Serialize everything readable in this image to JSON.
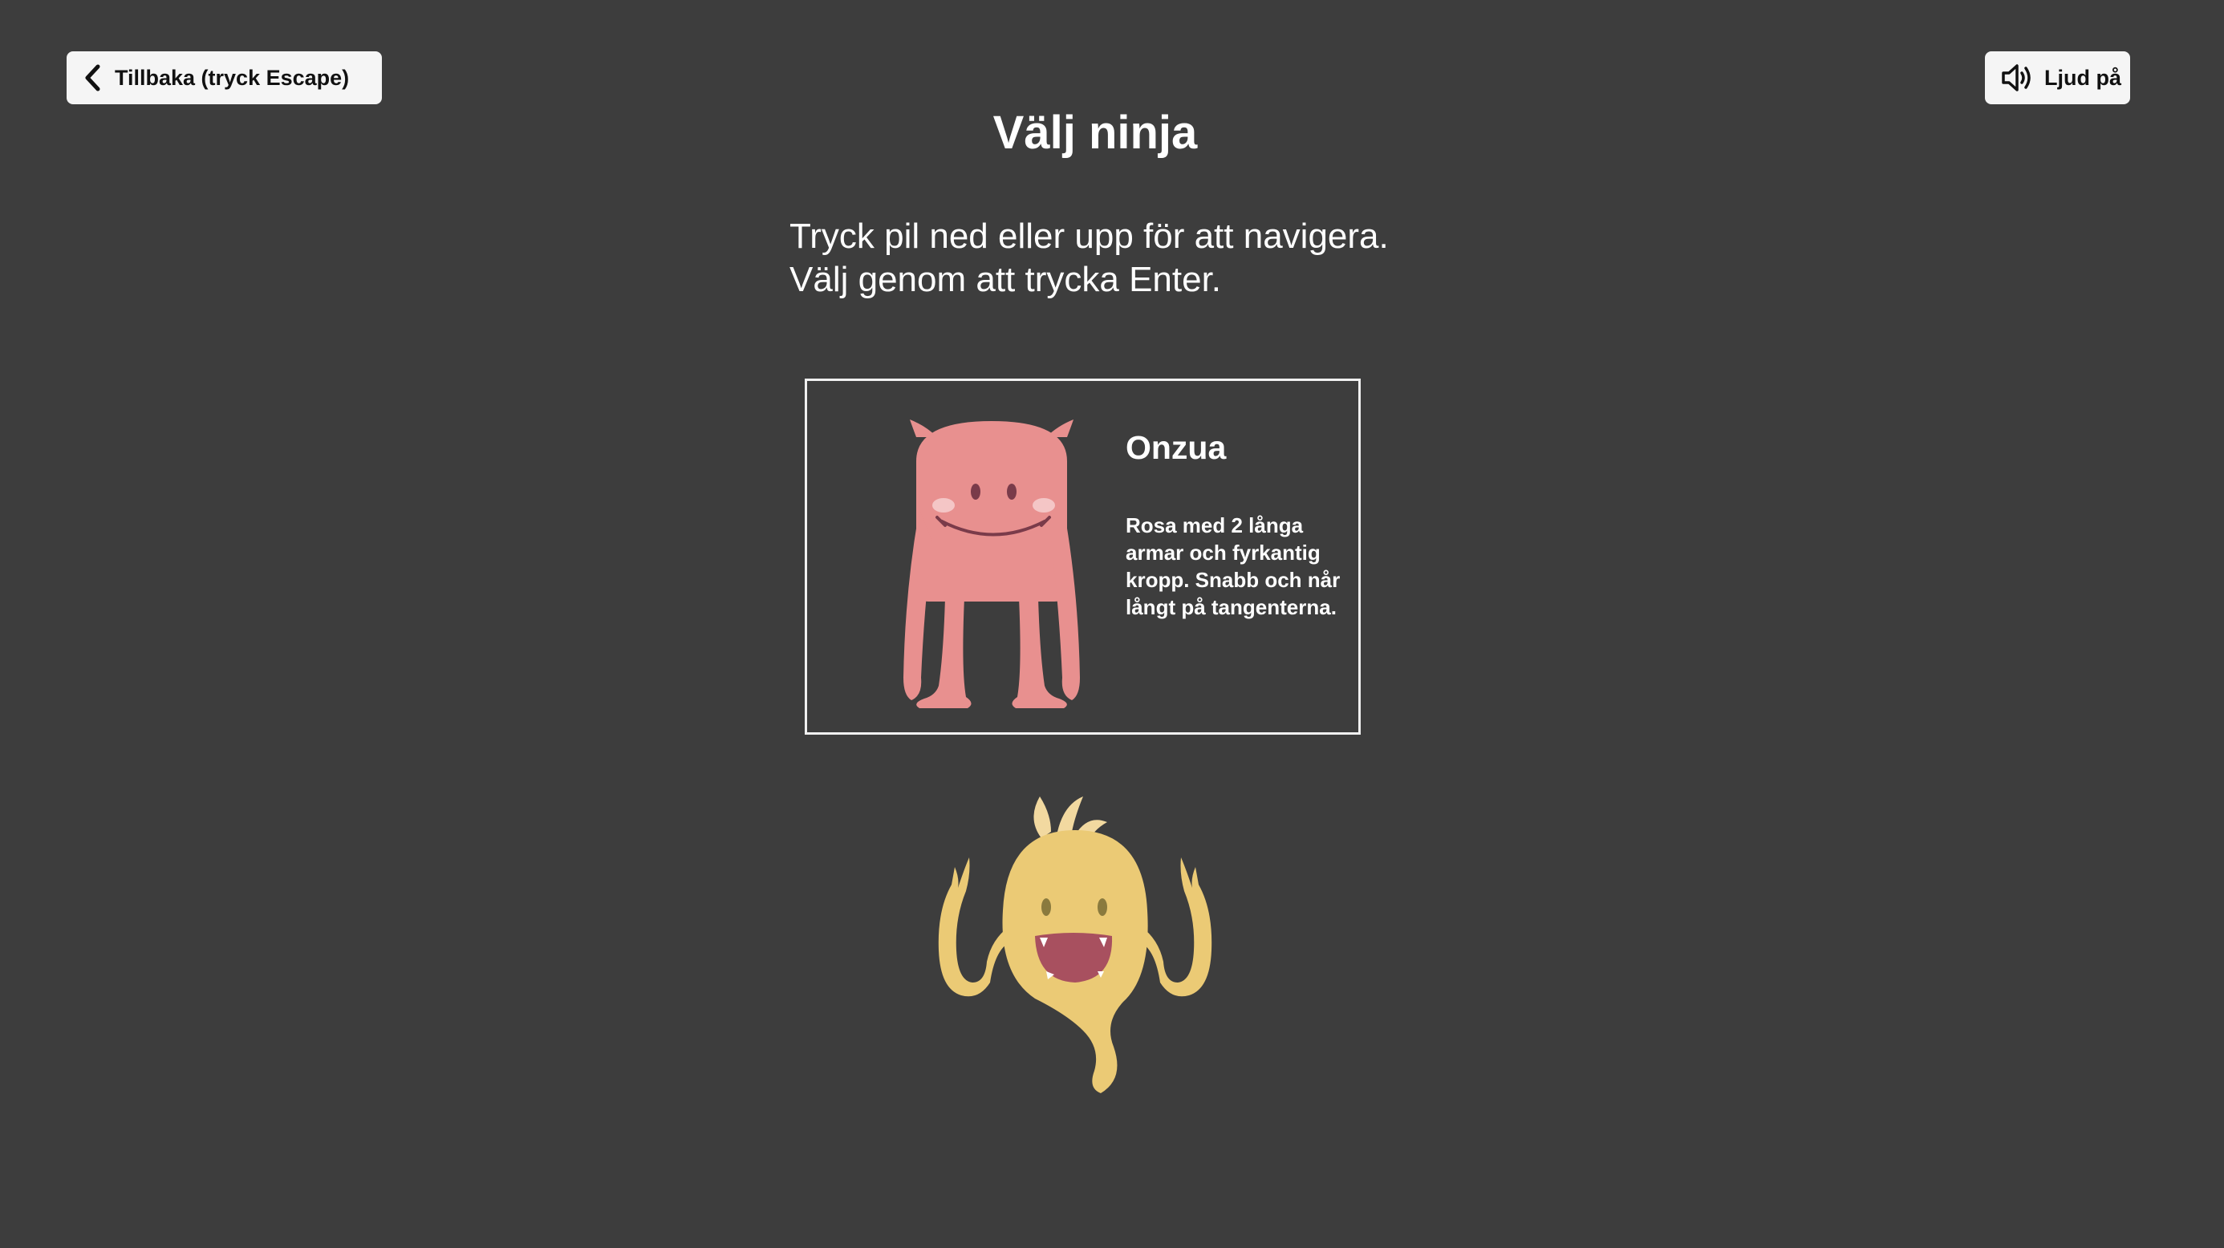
{
  "header": {
    "back_label": "Tillbaka (tryck Escape)",
    "sound_label": "Ljud på"
  },
  "title": "Välj ninja",
  "instructions": {
    "line1": "Tryck pil ned eller upp för att navigera.",
    "line2": "Välj genom att trycka Enter."
  },
  "ninjas": [
    {
      "name": "Onzua",
      "description": "Rosa med 2 långa armar och fyrkantig kropp. Snabb och når långt på tangenterna.",
      "color": "#e8908f",
      "selected": true
    },
    {
      "color": "#ebca75",
      "selected": false
    }
  ],
  "colors": {
    "background": "#3d3d3d",
    "button_background": "#f5f5f5",
    "text": "#ffffff"
  },
  "icons": {
    "back": "chevron-left-icon",
    "sound": "speaker-on-icon"
  }
}
